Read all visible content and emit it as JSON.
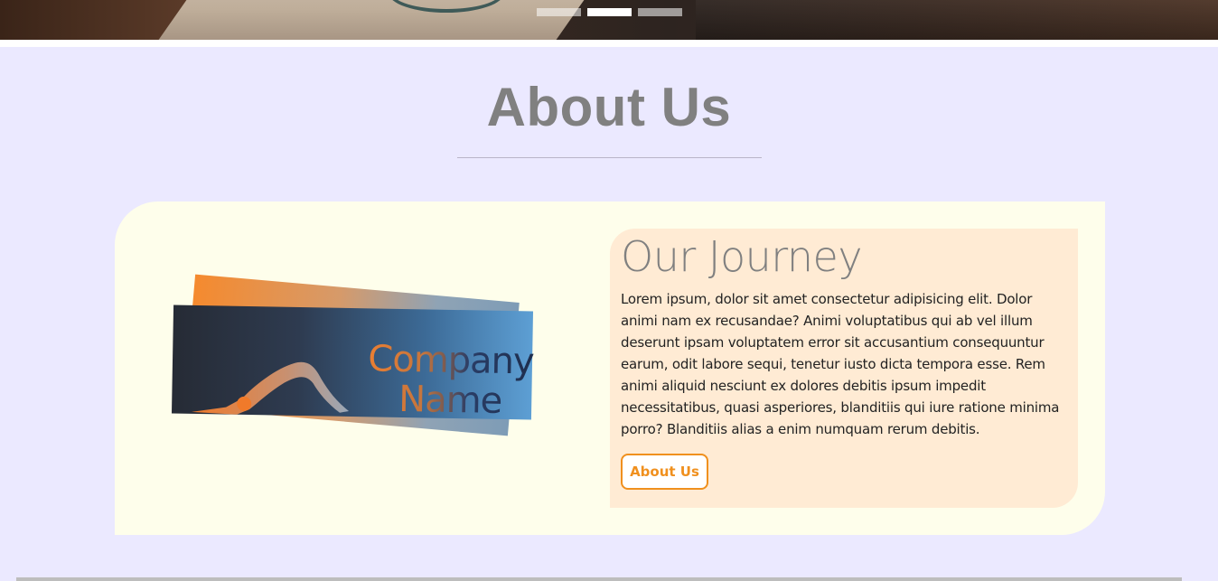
{
  "carousel": {
    "indicators": [
      {
        "label": "slide-1",
        "active": false
      },
      {
        "label": "slide-2",
        "active": true
      },
      {
        "label": "slide-3",
        "active": false
      }
    ]
  },
  "section": {
    "title": "About Us"
  },
  "card": {
    "logo": {
      "line1": "Company",
      "line2": "Name",
      "icon": "yoga-pose-icon"
    },
    "journey": {
      "heading": "Our Journey",
      "body": "Lorem ipsum, dolor sit amet consectetur adipisicing elit. Dolor animi nam ex recusandae? Animi voluptatibus qui ab vel illum deserunt ipsam voluptatem error sit accusantium consequuntur earum, odit labore sequi, tenetur iusto dicta tempora esse. Rem animi aliquid nesciunt ex dolores debitis ipsum impedit necessitatibus, quasi asperiores, blanditiis qui iure ratione minima porro? Blanditiis alias a enim numquam rerum debitis.",
      "button_label": "About Us"
    }
  },
  "colors": {
    "page_bg": "#ebe9ff",
    "card_bg": "#fefeeb",
    "journey_bg": "#ffebd4",
    "accent": "#f0901e",
    "title": "#808080"
  }
}
